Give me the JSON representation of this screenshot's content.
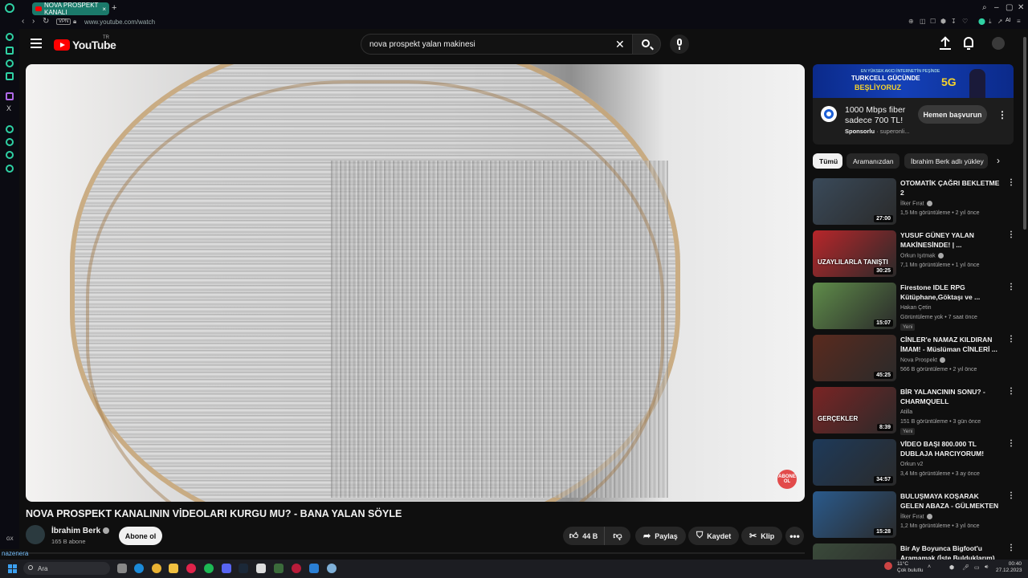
{
  "browser": {
    "tab_title": "NOVA PROSPEKT KANALI",
    "tab_close": "×",
    "new_tab": "+",
    "vpn_label": "VPN",
    "url": "www.youtube.com/watch",
    "ai_label": "AI"
  },
  "header": {
    "logo_text": "YouTube",
    "region": "TR",
    "search_value": "nova prospekt yalan makinesi",
    "clear_glyph": "✕"
  },
  "video": {
    "title": "NOVA PROSPEKT KANALININ VİDEOLARI KURGU MU? - BANA YALAN SÖYLE",
    "watermark": "ABONE OL",
    "channel_name": "İbrahim Berk",
    "subscribers": "165 B abone",
    "subscribe_label": "Abone ol",
    "likes": "44 B",
    "share_label": "Paylaş",
    "save_label": "Kaydet",
    "clip_label": "Klip",
    "more_glyph": "•••"
  },
  "ad": {
    "banner_line1": "EN YÜKSEK AKICI İNTERNET'İN PEŞİNDE",
    "banner_line2": "TURKCELL GÜCÜNDE",
    "banner_line3": "BEŞLİYORUZ",
    "banner_5g": "5G",
    "text": "1000 Mbps fiber sadece 700 TL!",
    "sponsored": "Sponsorlu",
    "advertiser": "superonli...",
    "cta": "Hemen başvurun",
    "menu": "⋮"
  },
  "chips": [
    "Tümü",
    "Aramanızdan",
    "İbrahim Berk adlı yükley"
  ],
  "recommendations": [
    {
      "title": "OTOMATİK ÇAĞRI BEKLETME 2",
      "channel": "İlker Fırat",
      "verified": true,
      "meta": "1,5 Mn görüntüleme • 2 yıl önce",
      "duration": "27:00",
      "badge": "",
      "thumb_text": "",
      "color": "#3a4a5a"
    },
    {
      "title": "YUSUF GÜNEY YALAN MAKİNESİNDE! | ...",
      "channel": "Orkun Işıtmak",
      "verified": true,
      "meta": "7,1 Mn görüntüleme • 1 yıl önce",
      "duration": "30:25",
      "badge": "",
      "thumb_text": "UZAYLILARLA TANIŞTI",
      "color": "#b8262a"
    },
    {
      "title": "Firestone IDLE RPG Kütüphane,Göktaşı ve ...",
      "channel": "Hakan Çetin",
      "verified": false,
      "meta": "Görüntüleme yok • 7 saat önce",
      "duration": "15:07",
      "badge": "Yeni",
      "thumb_text": "",
      "color": "#5f8c4a"
    },
    {
      "title": "CİNLER'e NAMAZ KILDIRAN İMAM! - Müslüman CİNLERİ ...",
      "channel": "Nova Prospekt",
      "verified": true,
      "meta": "566 B görüntüleme • 2 yıl önce",
      "duration": "45:25",
      "badge": "",
      "thumb_text": "",
      "color": "#5a2a1e"
    },
    {
      "title": "BİR YALANCININ SONU? - CHARMQUELL",
      "channel": "Atilla",
      "verified": false,
      "meta": "151 B görüntüleme • 3 gün önce",
      "duration": "8:39",
      "badge": "Yeni",
      "thumb_text": "GERÇEKLER",
      "color": "#7a2424"
    },
    {
      "title": "VİDEO BAŞI 800.000 TL DUBLAJA HARCIYORUM! Ruhi...",
      "channel": "Orkun v2",
      "verified": false,
      "meta": "3,4 Mn görüntüleme • 3 ay önce",
      "duration": "34:57",
      "badge": "",
      "thumb_text": "",
      "color": "#1e3a5a"
    },
    {
      "title": "BULUŞMAYA KOŞARAK GELEN ABAZA - GÜLMEKTEN ...",
      "channel": "İlker Fırat",
      "verified": true,
      "meta": "1,2 Mn görüntüleme • 3 yıl önce",
      "duration": "15:28",
      "badge": "",
      "thumb_text": "",
      "color": "#2a5a8c"
    },
    {
      "title": "Bir Ay Boyunca Bigfoot'u Aramamak (İşte Bulduklarım)",
      "channel": "",
      "verified": false,
      "meta": "",
      "duration": "",
      "badge": "",
      "thumb_text": "",
      "color": "#3a4a3a"
    }
  ],
  "corner": {
    "user": "nazenera",
    "gx": "GX"
  },
  "taskbar": {
    "search_placeholder": "Ara",
    "temp": "11°C",
    "weather": "Çok bulutlu",
    "time": "00:40",
    "date": "27.12.2023"
  }
}
